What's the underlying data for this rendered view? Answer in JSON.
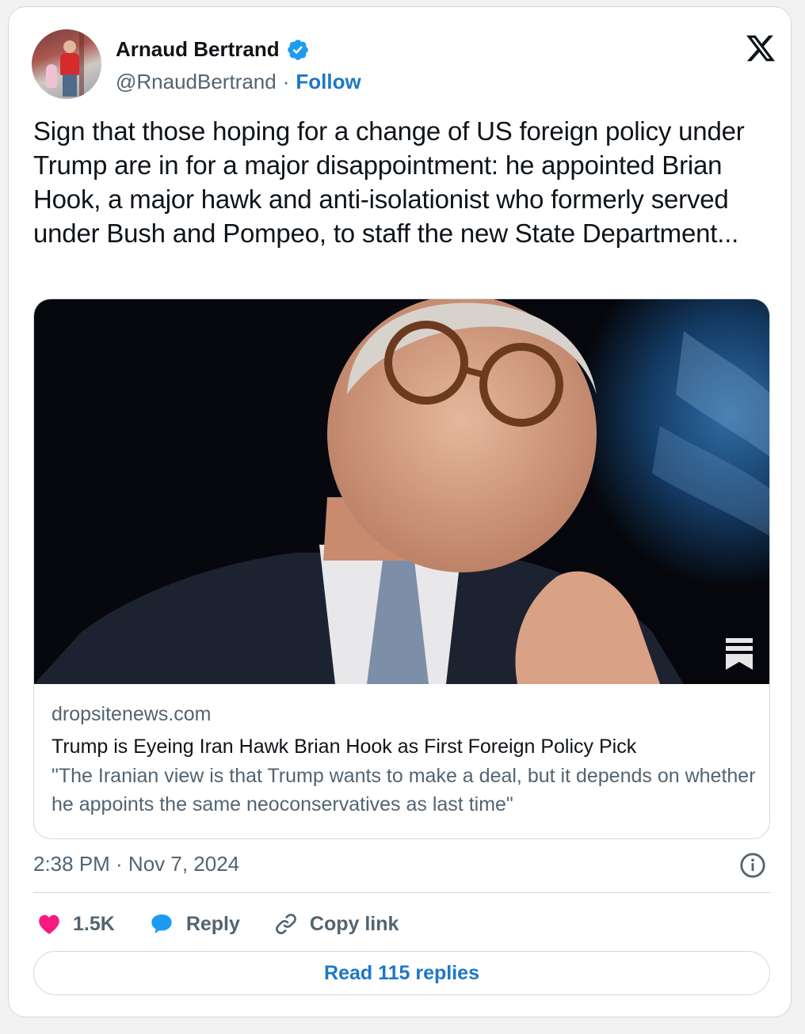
{
  "author": {
    "name": "Arnaud Bertrand",
    "handle": "@RnaudBertrand",
    "separator": "·",
    "follow_label": "Follow"
  },
  "tweet": {
    "text": "Sign that those hoping for a change of US foreign policy under Trump are in for a major disappointment: he appointed Brian Hook, a major hawk and anti-isolationist who formerly served under Bush and Pompeo, to staff the new State Department..."
  },
  "link_card": {
    "domain": "dropsitenews.com",
    "headline": "Trump is Eyeing Iran Hawk Brian Hook as First Foreign Policy Pick",
    "description": "\"The Iranian view is that Trump wants to make a deal, but it depends on whether he appoints the same neoconservatives as last time\"",
    "image_icon": "substack-bookmark-icon"
  },
  "timestamp": "2:38 PM · Nov 7, 2024",
  "actions": {
    "likes_count": "1.5K",
    "reply_label": "Reply",
    "copy_link_label": "Copy link"
  },
  "read_replies_label": "Read 115 replies",
  "icons": {
    "logo": "x-logo-icon",
    "verified": "verified-badge-icon",
    "info": "info-icon",
    "like": "heart-icon",
    "reply": "speech-bubble-icon",
    "copy": "link-icon"
  },
  "colors": {
    "accent": "#1d77c8",
    "like": "#f91880",
    "reply": "#1d9bf0",
    "muted": "#536471",
    "text": "#0f1419"
  }
}
